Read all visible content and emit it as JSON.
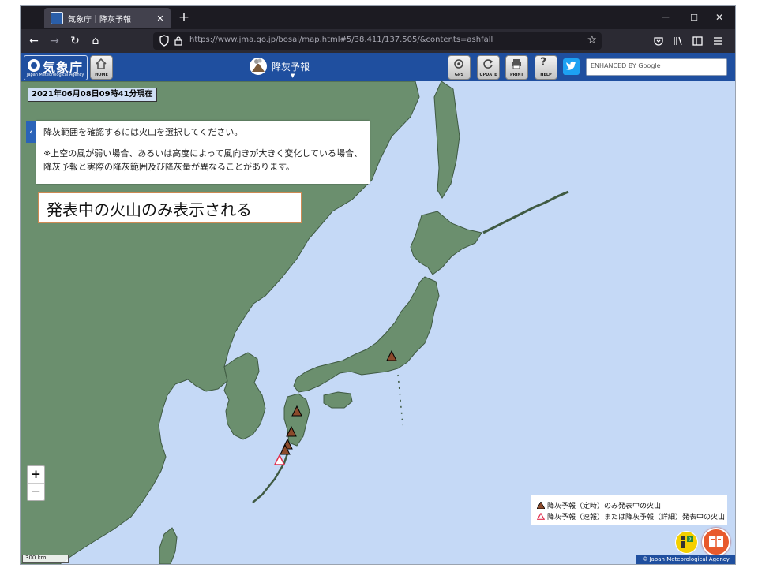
{
  "browser": {
    "tab_title": "気象庁｜降灰予報",
    "tab_close": "✕",
    "new_tab": "+",
    "window_controls": {
      "minimize": "−",
      "maximize": "☐",
      "close": "✕"
    },
    "nav": {
      "back": "←",
      "forward": "→",
      "reload": "↻",
      "home": "⌂"
    },
    "url": "https://www.jma.go.jp/bosai/map.html#5/38.411/137.505/&contents=ashfall",
    "toolbar_icons": [
      "pocket-icon",
      "library-icon",
      "sidebar-icon",
      "menu-icon"
    ]
  },
  "header": {
    "logo_name": "気象庁",
    "logo_subtitle": "Japan Meteorological Agency",
    "home_label": "HOME",
    "product_title": "降灰予報",
    "product_caret": "▼",
    "buttons": {
      "gps": "GPS",
      "update": "UPDATE",
      "print": "PRINT",
      "help": "HELP"
    },
    "search_placeholder": "ENHANCED BY Google"
  },
  "map": {
    "timestamp": "2021年06月08日09時41分現在",
    "info_line1": "降灰範囲を確認するには火山を選択してください。",
    "info_line2": "※上空の風が弱い場合、あるいは高度によって風向きが大きく変化している場合、降灰予報と実際の降灰範囲及び降灰量が異なることがあります。",
    "callout": "発表中の火山のみ表示される",
    "zoom_in": "+",
    "zoom_out": "−",
    "scale_label": "300 km",
    "legend": {
      "item1": "降灰予報（定時）のみ発表中の火山",
      "item2": "降灰予報（速報）または降灰予報（詳細）発表中の火山"
    },
    "copyright": "© Japan Meteorological Agency"
  },
  "colors": {
    "land": "#6b8f6e",
    "sea": "#c5d9f6",
    "header_blue": "#1f4f9f",
    "volcano_brown": "#8b4a2b",
    "volcano_outline_red": "#e0304e"
  }
}
